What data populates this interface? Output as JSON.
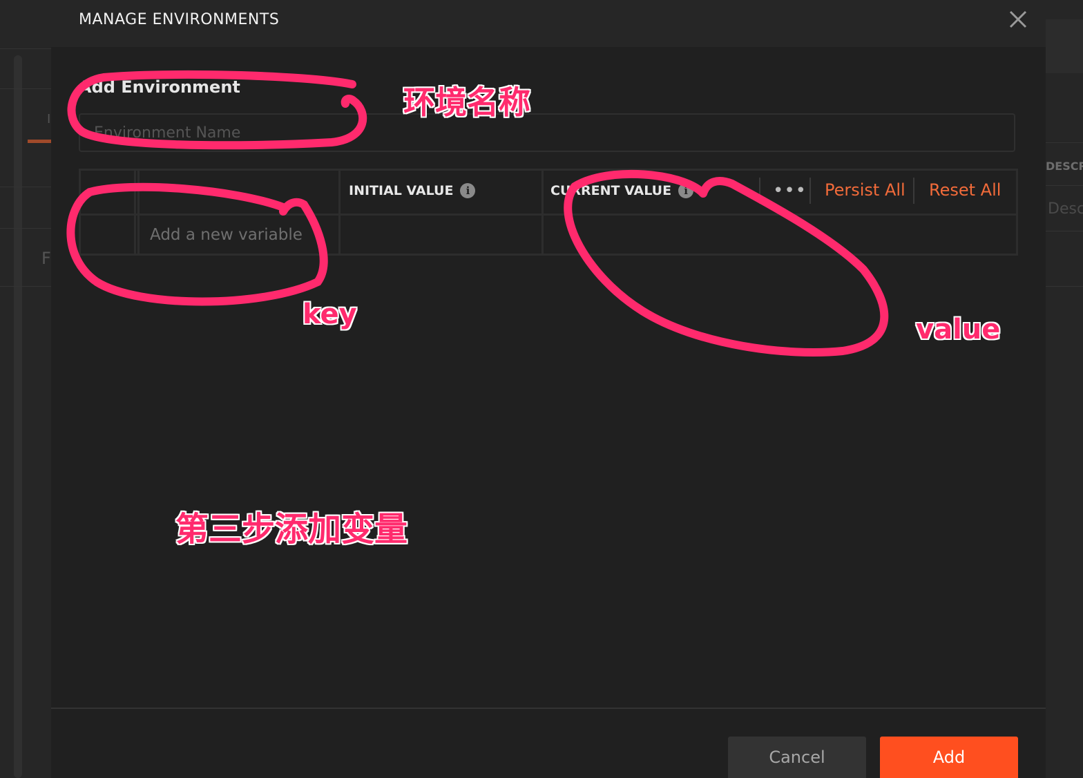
{
  "modal": {
    "title": "MANAGE ENVIRONMENTS",
    "section_label": "Add Environment",
    "name_input": {
      "value": "",
      "placeholder": "Environment Name"
    }
  },
  "table": {
    "headers": {
      "key": "",
      "initial_value": "INITIAL VALUE",
      "current_value": "CURRENT VALUE"
    },
    "more_menu": "•••",
    "persist_all": "Persist All",
    "reset_all": "Reset All",
    "new_row": {
      "key_placeholder": "Add a new variable",
      "initial_value": "",
      "current_value": ""
    }
  },
  "footer": {
    "cancel_label": "Cancel",
    "add_label": "Add"
  },
  "background": {
    "right_header": "DESCR",
    "right_placeholder": "Desc",
    "left_fragment_1": "I",
    "left_fragment_2": "F"
  },
  "annotations": {
    "env_name": "环境名称",
    "key": "key",
    "value": "value",
    "step": "第三步添加变量",
    "color": "#ff2a6d"
  },
  "icons": {
    "close": "close-icon",
    "info": "info-icon",
    "more": "more-horizontal-icon"
  },
  "colors": {
    "accent": "#ff4f1f",
    "link": "#f26b3a",
    "modal_bg": "#202020",
    "header_bg": "#262626"
  }
}
